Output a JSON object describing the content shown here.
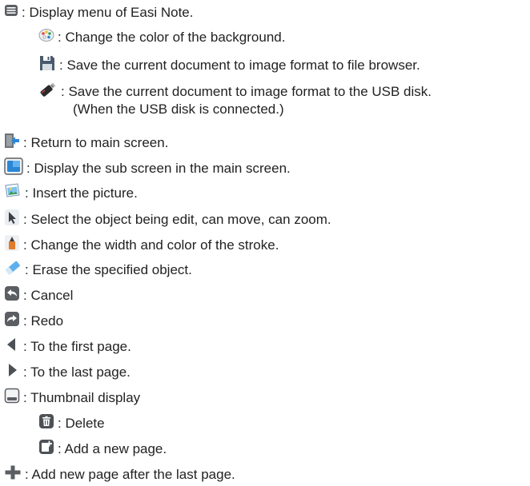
{
  "items": [
    {
      "icon": "menu-icon",
      "text": ": Display menu of Easi Note."
    },
    {
      "icon": "palette-icon",
      "text": ": Change the color of the background."
    },
    {
      "icon": "floppy-disk-icon",
      "text": ": Save the current document to image format to file browser."
    },
    {
      "icon": "usb-drive-icon",
      "text": ": Save the current document to image format to the USB disk.",
      "continuation": "(When the USB disk is connected.)"
    },
    {
      "icon": "exit-icon",
      "text": ": Return to main screen."
    },
    {
      "icon": "sub-screen-icon",
      "text": ": Display the sub screen in the main screen."
    },
    {
      "icon": "picture-icon",
      "text": ": Insert the picture."
    },
    {
      "icon": "cursor-arrow-icon",
      "text": ": Select the object being edit, can move, can zoom."
    },
    {
      "icon": "pen-icon",
      "text": ": Change the width and color of the stroke."
    },
    {
      "icon": "eraser-icon",
      "text": ": Erase the specified object."
    },
    {
      "icon": "undo-icon",
      "text": ": Cancel"
    },
    {
      "icon": "redo-icon",
      "text": ": Redo"
    },
    {
      "icon": "first-page-icon",
      "text": ": To the first page."
    },
    {
      "icon": "last-page-icon",
      "text": ": To the last page."
    },
    {
      "icon": "thumbnail-icon",
      "text": ": Thumbnail display"
    },
    {
      "icon": "trash-icon",
      "text": ": Delete"
    },
    {
      "icon": "add-page-icon",
      "text": ": Add a new page."
    },
    {
      "icon": "plus-icon",
      "text": ": Add new page after the last page."
    }
  ],
  "colors": {
    "text": "#222222",
    "icon_gray": "#5b5e62",
    "icon_blue": "#2b86d6",
    "icon_orange": "#e27b2a"
  }
}
